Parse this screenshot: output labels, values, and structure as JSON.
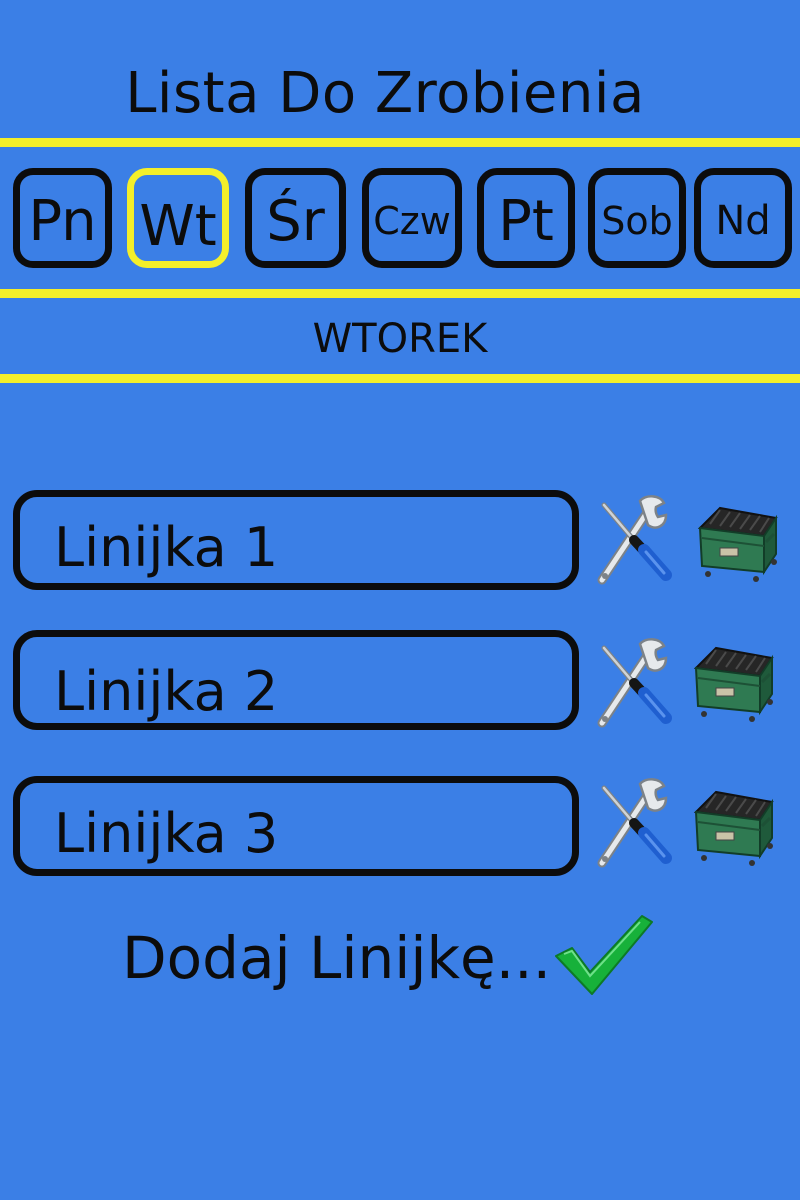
{
  "header": {
    "title": "Lista Do Zrobienia"
  },
  "days": [
    {
      "id": "pn",
      "label": "Pn",
      "selected": false
    },
    {
      "id": "wt",
      "label": "Wt",
      "selected": true
    },
    {
      "id": "sr",
      "label": "Śr",
      "selected": false
    },
    {
      "id": "czw",
      "label": "Czw",
      "selected": false
    },
    {
      "id": "pt",
      "label": "Pt",
      "selected": false
    },
    {
      "id": "sob",
      "label": "Sob",
      "selected": false
    },
    {
      "id": "nd",
      "label": "Nd",
      "selected": false
    }
  ],
  "selected_day_name": "WTOREK",
  "lines": [
    {
      "text": "Linijka 1",
      "edit_icon": "wrench-screwdriver-icon",
      "delete_icon": "dumpster-icon"
    },
    {
      "text": "Linijka 2",
      "edit_icon": "wrench-screwdriver-icon",
      "delete_icon": "dumpster-icon"
    },
    {
      "text": "Linijka 3",
      "edit_icon": "wrench-screwdriver-icon",
      "delete_icon": "dumpster-icon"
    }
  ],
  "add_line": {
    "label": "Dodaj Linijkę...",
    "icon": "checkmark-icon"
  },
  "colors": {
    "background": "#3b7fe6",
    "accent_yellow": "#f4ef2a",
    "outline": "#0c0c0c",
    "dumpster_green": "#2f7a52",
    "checkmark_green": "#17b13a",
    "tool_handle_blue": "#1f5fd0"
  }
}
